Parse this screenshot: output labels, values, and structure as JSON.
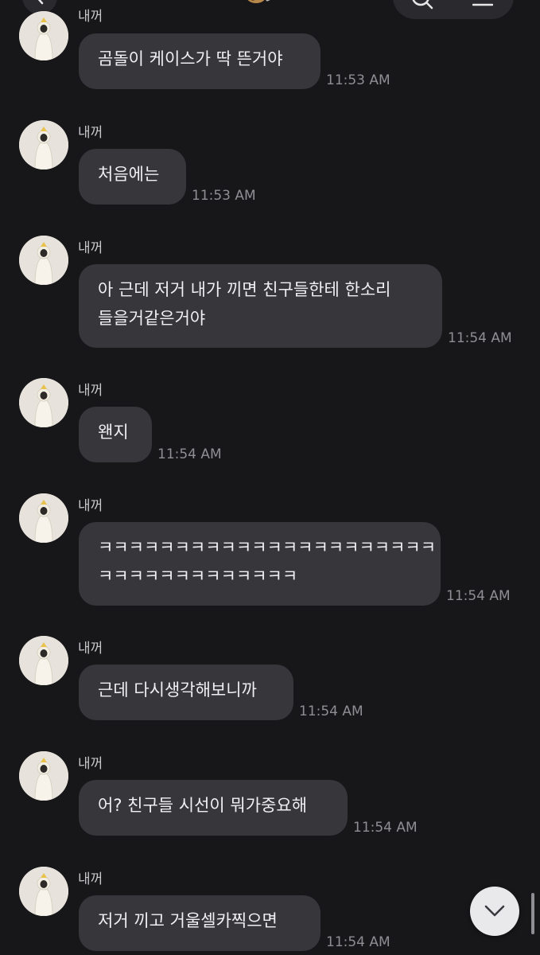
{
  "header": {
    "back_icon": "chevron-left-icon",
    "emoji_icon": "bear-emoji-icon",
    "search_icon": "search-icon",
    "menu_icon": "hamburger-menu-icon"
  },
  "messages": [
    {
      "sender": "내꺼",
      "text": "곰돌이 케이스가 딱 뜬거야",
      "time": "11:53 AM"
    },
    {
      "sender": "내꺼",
      "text": "처음에는",
      "time": "11:53 AM"
    },
    {
      "sender": "내꺼",
      "lines": [
        "아 근데 저거 내가 끼면 친구들한테 한소리",
        "들을거같은거야"
      ],
      "time": "11:54 AM"
    },
    {
      "sender": "내꺼",
      "text": "왠지",
      "time": "11:54 AM"
    },
    {
      "sender": "내꺼",
      "lines": [
        "ㅋㅋㅋㅋㅋㅋㅋㅋㅋㅋㅋㅋㅋㅋㅋㅋㅋㅋㅋㅋㅋㅋ",
        "ㅋㅋㅋㅋㅋㅋㅋㅋㅋㅋㅋㅋㅋ"
      ],
      "time": "11:54 AM"
    },
    {
      "sender": "내꺼",
      "text": "근데 다시생각해보니까",
      "time": "11:54 AM"
    },
    {
      "sender": "내꺼",
      "text": "어? 친구들 시선이 뭐가중요해",
      "time": "11:54 AM"
    },
    {
      "sender": "내꺼",
      "text": "저거 끼고 거울셀카찍으면",
      "time": "11:54 AM"
    }
  ],
  "scroll_down_icon": "chevron-down-icon"
}
